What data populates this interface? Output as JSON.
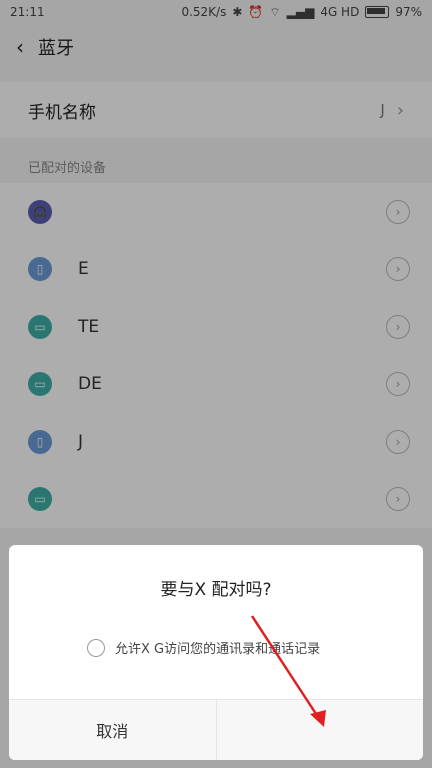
{
  "status": {
    "time": "21:11",
    "speed": "0.52K/s",
    "network": "4G HD",
    "battery": "97%"
  },
  "header": {
    "back_icon": "‹",
    "title": "蓝牙"
  },
  "phone_name": {
    "label": "手机名称",
    "value": "J",
    "chevron": "›"
  },
  "paired_section": {
    "label": "已配对的设备"
  },
  "devices": [
    {
      "name": "",
      "icon": "headphones-icon",
      "color": "#5b5fb6"
    },
    {
      "name": "E",
      "icon": "phone-icon",
      "color": "#6a9bd8"
    },
    {
      "name": "TE",
      "icon": "laptop-icon",
      "color": "#3fb0a8"
    },
    {
      "name": "DE",
      "icon": "laptop-icon",
      "color": "#3fb0a8"
    },
    {
      "name": "J",
      "icon": "phone-icon",
      "color": "#6a9bd8"
    },
    {
      "name": "",
      "icon": "laptop-icon",
      "color": "#3fb0a8"
    }
  ],
  "dialog": {
    "title": "要与X          配对吗?",
    "permission": "允许X        G访问您的通讯录和通话记录",
    "cancel": "取消",
    "confirm": ""
  }
}
